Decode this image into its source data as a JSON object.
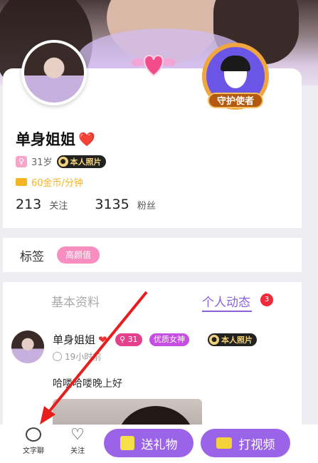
{
  "profile": {
    "name": "单身姐姐",
    "name_heart": "❤️",
    "gender_symbol": "♀",
    "age": "31岁",
    "real_photo": "本人照片",
    "price": "60金币/分钟",
    "following_count": "213",
    "following_label": "关注",
    "fans_count": "3135",
    "fans_label": "粉丝",
    "guardian_label": "守护使者"
  },
  "tags": {
    "title": "标签",
    "items": [
      "高颜值"
    ]
  },
  "tabs": {
    "basic": "基本资料",
    "dynamic": "个人动态",
    "dynamic_count": "3"
  },
  "post": {
    "name": "单身姐姐",
    "heart": "❤",
    "level": "31",
    "goddess": "优质女神",
    "real_photo": "本人照片",
    "time": "19小时前",
    "text": "哈喽哈喽晚上好"
  },
  "bottom_bar": {
    "chat_label": "文字聊",
    "follow_label": "关注",
    "gift_label": "送礼物",
    "video_label": "打视频"
  },
  "colors": {
    "accent": "#9a63e8",
    "tag_pink": "#f88dbf",
    "gold": "#f1b628"
  }
}
